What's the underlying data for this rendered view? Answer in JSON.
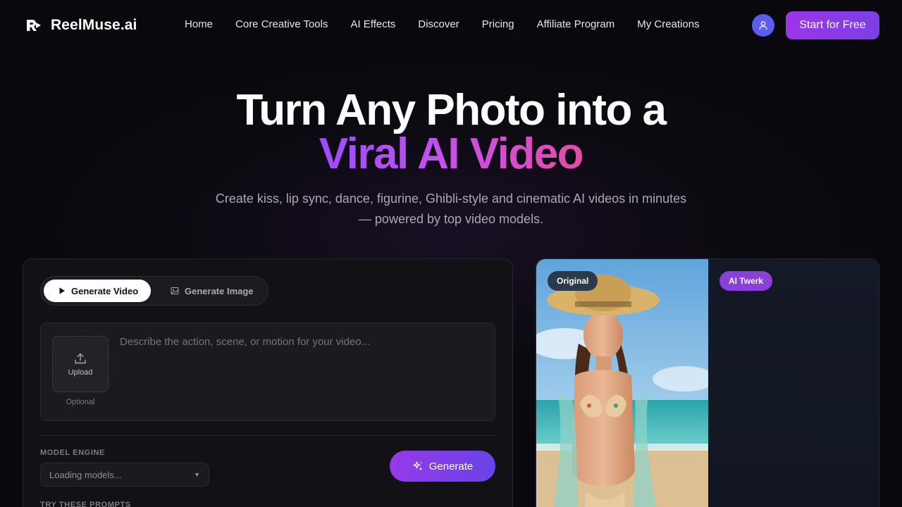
{
  "brand": {
    "name": "ReelMuse.ai",
    "logo_icon": "reelmuse-logo-icon"
  },
  "nav": {
    "items": [
      {
        "label": "Home"
      },
      {
        "label": "Core Creative Tools"
      },
      {
        "label": "AI Effects"
      },
      {
        "label": "Discover"
      },
      {
        "label": "Pricing"
      },
      {
        "label": "Affiliate Program"
      },
      {
        "label": "My Creations"
      }
    ],
    "user_icon": "user-icon",
    "cta_label": "Start for Free"
  },
  "hero": {
    "title_line1": "Turn Any Photo into a",
    "title_line2": "Viral AI Video",
    "subtitle": "Create kiss, lip sync, dance, figurine, Ghibli-style and cinematic AI videos in minutes — powered by top video models."
  },
  "generator": {
    "tabs": [
      {
        "label": "Generate Video",
        "icon": "play-icon",
        "active": true
      },
      {
        "label": "Generate Image",
        "icon": "image-icon",
        "active": false
      }
    ],
    "upload_label": "Upload",
    "upload_hint": "Optional",
    "prompt_placeholder": "Describe the action, scene, or motion for your video...",
    "model_engine_label": "MODEL ENGINE",
    "model_select_value": "Loading models...",
    "generate_label": "Generate",
    "prompts_label": "TRY THESE PROMPTS"
  },
  "preview": {
    "original_badge": "Original",
    "effect_badge": "AI Twerk"
  },
  "colors": {
    "accent_start": "#9b35e8",
    "accent_end": "#6a43e6",
    "gradient_pink": "#e94aa7",
    "background": "#09090d"
  }
}
